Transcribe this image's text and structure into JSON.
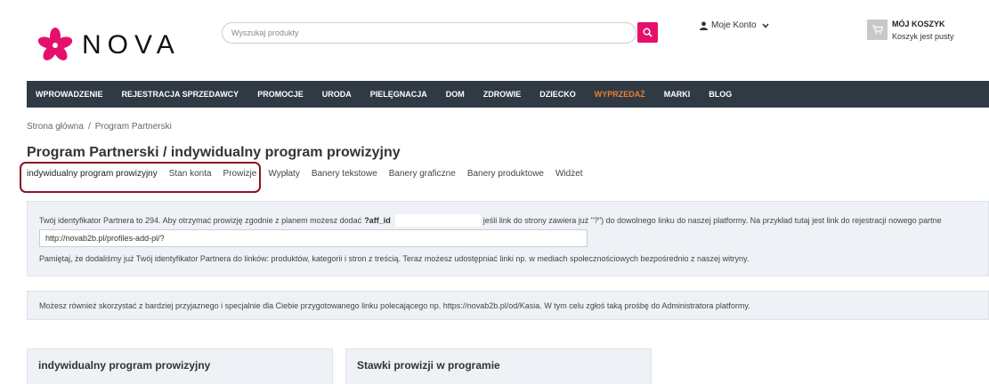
{
  "brand": {
    "name": "NOVA",
    "accent": "#e5106c"
  },
  "search": {
    "placeholder": "Wyszukaj produkty",
    "icon": "search-icon"
  },
  "account": {
    "label": "Moje Konto",
    "icon": "user-icon"
  },
  "cart": {
    "title": "MÓJ KOSZYK",
    "status": "Koszyk jest pusty",
    "icon": "cart-icon"
  },
  "nav": {
    "items": [
      {
        "label": "WPROWADZENIE"
      },
      {
        "label": "REJESTRACJA SPRZEDAWCY"
      },
      {
        "label": "PROMOCJE"
      },
      {
        "label": "URODA"
      },
      {
        "label": "PIELĘGNACJA"
      },
      {
        "label": "DOM"
      },
      {
        "label": "ZDROWIE"
      },
      {
        "label": "DZIECKO"
      },
      {
        "label": "WYPRZEDAŻ",
        "accent_color": "#f07d2b"
      },
      {
        "label": "MARKI"
      },
      {
        "label": "BLOG"
      }
    ]
  },
  "breadcrumb": {
    "home": "Strona główna",
    "separator": "/",
    "current": "Program Partnerski"
  },
  "page": {
    "title": "Program Partnerski / indywidualny program prowizyjny"
  },
  "tabs": [
    {
      "label": "indywidualny program prowizyjny",
      "active": true
    },
    {
      "label": "Stan konta"
    },
    {
      "label": "Prowizje"
    },
    {
      "label": "Wypłaty"
    },
    {
      "label": "Banery tekstowe"
    },
    {
      "label": "Banery graficzne"
    },
    {
      "label": "Banery produktowe"
    },
    {
      "label": "Widżet"
    }
  ],
  "partner_panel": {
    "intro": "Twój identyfikator Partnera to 294. Aby otrzymać prowizję zgodnie z planem możesz dodać",
    "param": "?aff_id",
    "intro_cont": "jeśli link do strony zawiera już \"?\") do dowolnego linku do naszej platformy. Na przykład tutaj jest link do rejestracji nowego partne",
    "ref_link": "http://novab2b.pl/profiles-add-pl/?",
    "reminder": "Pamiętaj, że dodaliśmy już Twój identyfikator Partnera do linków: produktów, kategorii i stron z treścią. Teraz możesz udostępniać linki np. w mediach społecznościowych bezpośrednio z naszej witryny."
  },
  "friendly_link_note": "Możesz również skorzystać z bardziej przyjaznego i specjalnie dla Ciebie przygotowanego linku polecającego np. https://novab2b.pl/od/Kasia. W tym celu zgłoś taką prośbę do Administratora platformy.",
  "cards": [
    {
      "title": "indywidualny program prowizyjny"
    },
    {
      "title": "Stawki prowizji w programie"
    }
  ]
}
